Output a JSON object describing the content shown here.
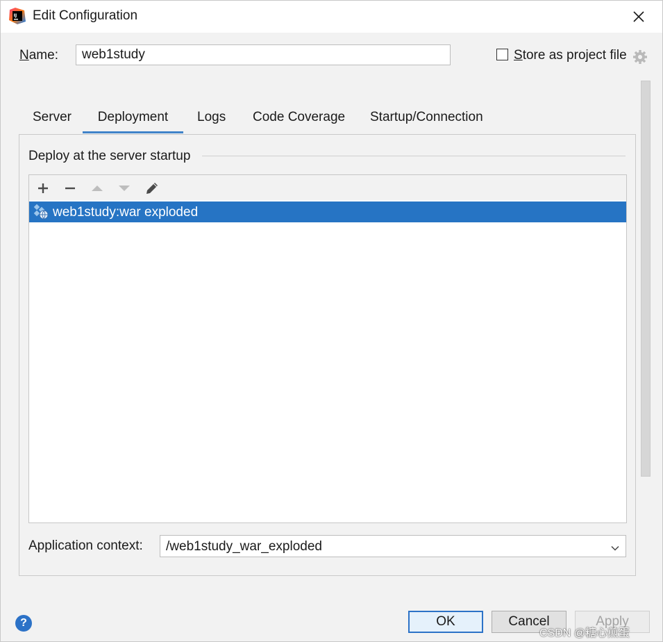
{
  "window": {
    "title": "Edit Configuration",
    "app_logo_text": "IJ"
  },
  "name_row": {
    "label_underlined": "N",
    "label_rest": "ame:",
    "value": "web1study"
  },
  "store_option": {
    "label_underlined": "S",
    "label_rest": "tore as project file",
    "checked": false
  },
  "tabs": [
    {
      "label": "Server",
      "active": false
    },
    {
      "label": "Deployment",
      "active": true
    },
    {
      "label": "Logs",
      "active": false
    },
    {
      "label": "Code Coverage",
      "active": false
    },
    {
      "label": "Startup/Connection",
      "active": false
    }
  ],
  "deployment": {
    "group_title": "Deploy at the server startup",
    "toolbar_icons": [
      "add-icon",
      "remove-icon",
      "move-up-icon",
      "move-down-icon",
      "edit-icon"
    ],
    "artifacts": [
      {
        "label": "web1study:war exploded",
        "selected": true
      }
    ],
    "context_label": "Application context:",
    "context_value": "/web1study_war_exploded"
  },
  "buttons": {
    "help": "?",
    "ok": "OK",
    "cancel": "Cancel",
    "apply": "Apply"
  },
  "watermark": "CSDN @糖心煎蛋",
  "colors": {
    "accent": "#2c72c7",
    "selection": "#2674c4",
    "tab_indicator": "#4083c9"
  }
}
